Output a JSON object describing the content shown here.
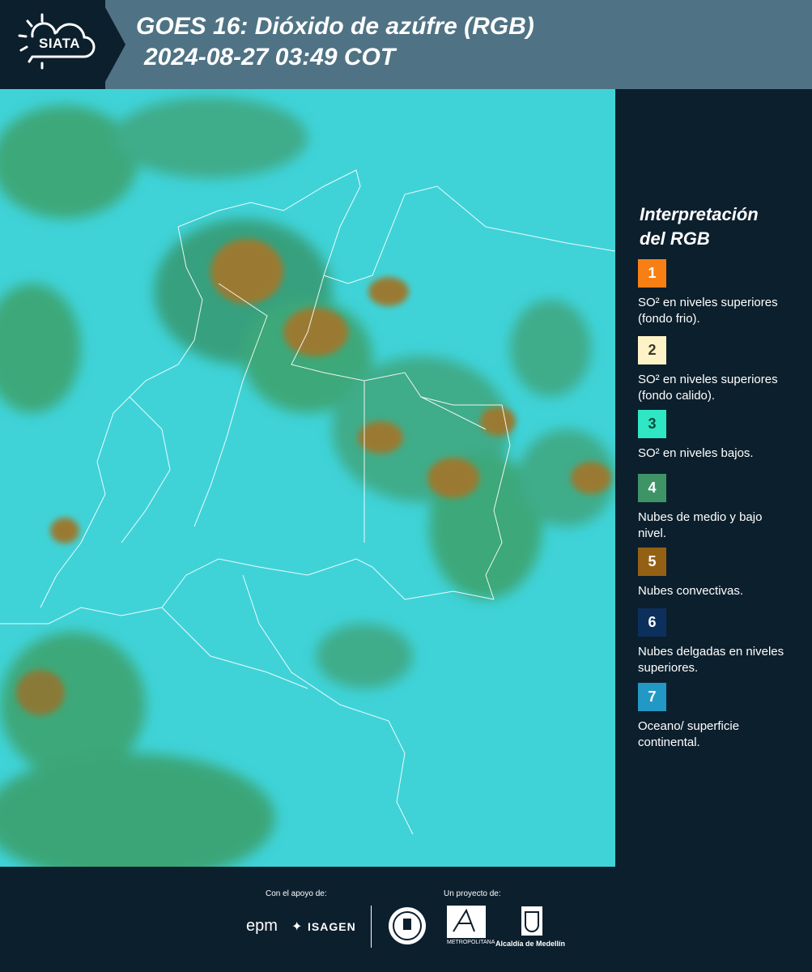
{
  "header": {
    "logo_text": "SIATA",
    "title_line1": "GOES 16: Dióxido de azúfre (RGB)",
    "title_line2": "2024-08-27 03:49 COT"
  },
  "legend": {
    "title_line1": "Interpretación",
    "title_line2": "del RGB",
    "items": [
      {
        "num": "1",
        "label": "SO² en niveles superiores (fondo frio).",
        "color": "#f77f14"
      },
      {
        "num": "2",
        "label": "SO² en niveles superiores (fondo calido).",
        "color": "#fdf3c6"
      },
      {
        "num": "3",
        "label": "SO² en niveles bajos.",
        "color": "#2ee6c4"
      },
      {
        "num": "4",
        "label": "Nubes de medio y bajo nivel.",
        "color": "#3e9466"
      },
      {
        "num": "5",
        "label": "Nubes convectivas.",
        "color": "#946114"
      },
      {
        "num": "6",
        "label": "Nubes delgadas en niveles superiores.",
        "color": "#0d2f5c"
      },
      {
        "num": "7",
        "label": "Oceano/ superficie continental.",
        "color": "#2199c4"
      }
    ]
  },
  "footer": {
    "support_label": "Con el apoyo de:",
    "project_label": "Un proyecto de:",
    "sponsor1": "epm",
    "sponsor2": "ISAGEN",
    "partner1": "METROPOLITANA",
    "partner2": "Alcaldía de Medellín"
  },
  "colors": {
    "map_background": "#3fd3d8",
    "cloud_green": "#3d9a5a",
    "convective": "#9a7a30",
    "header_bg": "#4f7384",
    "panel_bg": "#0c1f2d"
  }
}
